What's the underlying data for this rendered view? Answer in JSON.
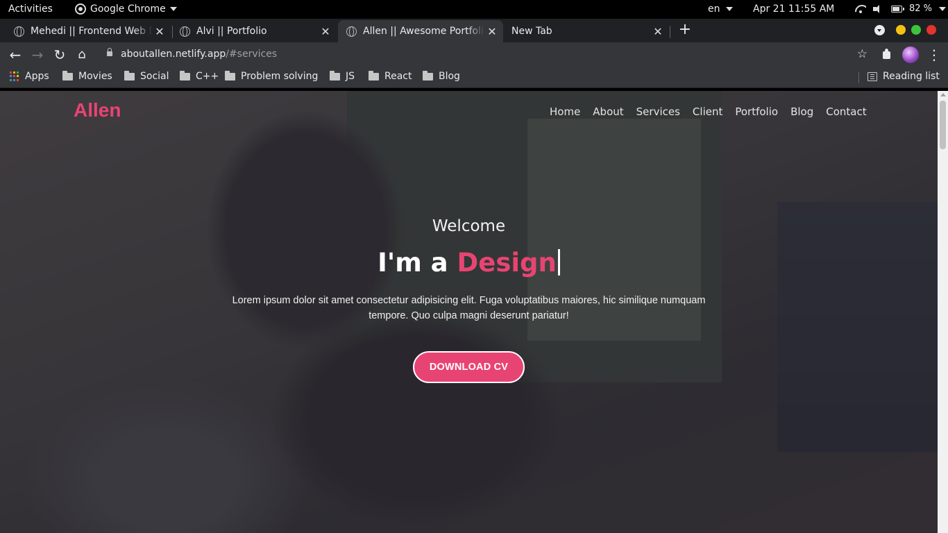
{
  "system_bar": {
    "activities": "Activities",
    "app_name": "Google Chrome",
    "language": "en",
    "datetime": "Apr 21  11:55 AM",
    "battery": "82 %",
    "battery_level": 0.82
  },
  "tabs": [
    {
      "title": "Mehedi || Frontend Web Developer",
      "active": false
    },
    {
      "title": "Alvi || Portfolio",
      "active": false
    },
    {
      "title": "Allen || Awesome Portfolio",
      "active": true
    },
    {
      "title": "New Tab",
      "active": false
    }
  ],
  "address_bar": {
    "host": "aboutallen.netlify.app",
    "path": "/#services"
  },
  "bookmarks": {
    "apps": "Apps",
    "items": [
      "Movies",
      "Social",
      "C++",
      "Problem solving",
      "JS",
      "React",
      "Blog"
    ],
    "reading_list": "Reading list"
  },
  "colors": {
    "accent": "#e84473",
    "chrome_dark": "#202124",
    "toolbar": "#35363a"
  },
  "site": {
    "logo": "Allen",
    "nav": [
      "Home",
      "About",
      "Services",
      "Client",
      "Portfolio",
      "Blog",
      "Contact"
    ],
    "hero": {
      "welcome": "Welcome",
      "headline_prefix": "I'm a",
      "headline_word": "Design",
      "paragraph": "Lorem ipsum dolor sit amet consectetur adipisicing elit. Fuga voluptatibus maiores, hic similique numquam tempore. Quo culpa magni deserunt pariatur!",
      "cta": "DOWNLOAD CV"
    }
  }
}
